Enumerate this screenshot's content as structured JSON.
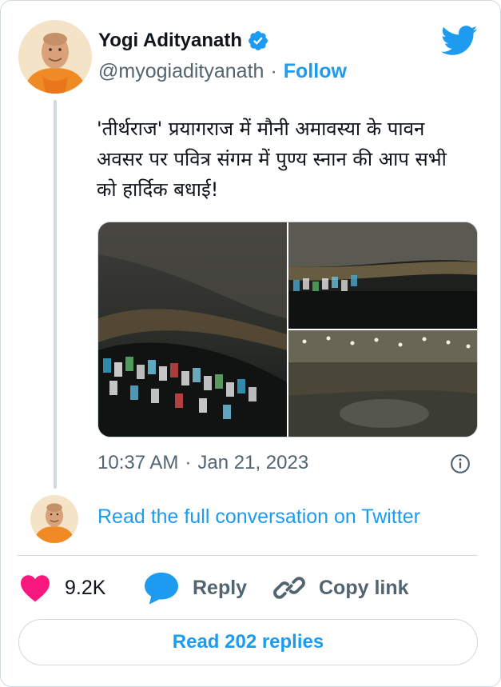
{
  "author": {
    "name": "Yogi Adityanath",
    "handle": "@myogiadityanath",
    "separator": "·",
    "follow_label": "Follow"
  },
  "tweet": {
    "text": "'तीर्थराज' प्रयागराज में मौनी अमावस्या के पावन अवसर पर पवित्र संगम में पुण्य स्नान की आप सभी को हार्दिक बधाई!",
    "time": "10:37 AM",
    "date_separator": "·",
    "date": "Jan 21, 2023"
  },
  "conversation_link": "Read the full conversation on Twitter",
  "actions": {
    "likes": "9.2K",
    "reply_label": "Reply",
    "copy_label": "Copy link"
  },
  "read_replies_label": "Read 202 replies",
  "colors": {
    "accent": "#1d9bf0",
    "like": "#f91880",
    "secondary_text": "#536471",
    "border": "#cfd9de"
  },
  "icons": {
    "verified": "verified-badge-icon",
    "twitter": "twitter-bird-icon",
    "info": "info-icon",
    "like": "heart-icon",
    "reply": "speech-bubble-icon",
    "copy": "link-icon"
  }
}
